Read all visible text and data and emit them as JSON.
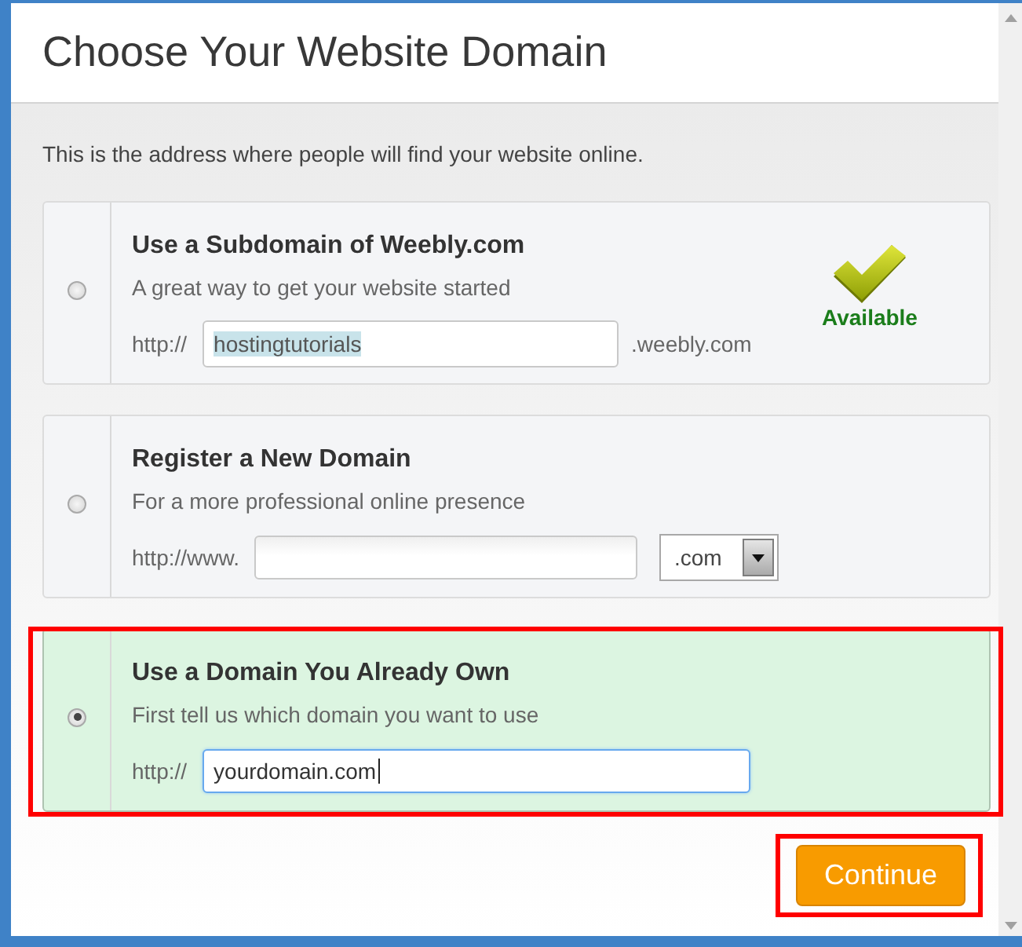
{
  "dialog": {
    "title": "Choose Your Website Domain",
    "intro": "This is the address where people will find your website online."
  },
  "options": [
    {
      "kind": "subdomain",
      "selected": false,
      "highlighted": false,
      "title": "Use a Subdomain of Weebly.com",
      "subtitle": "A great way to get your website started",
      "prefix": "http://",
      "value": "hostingtutorials",
      "value_selected": true,
      "focused": false,
      "suffix": ".weebly.com",
      "status": "Available"
    },
    {
      "kind": "register",
      "selected": false,
      "highlighted": false,
      "title": "Register a New Domain",
      "subtitle": "For a more professional online presence",
      "prefix": "http://www.",
      "extension": ".com"
    },
    {
      "kind": "existing",
      "selected": true,
      "highlighted": true,
      "title": "Use a Domain You Already Own",
      "subtitle": "First tell us which domain you want to use",
      "prefix": "http://",
      "value": "yourdomain.com",
      "value_selected": false,
      "focused": true
    }
  ],
  "continue_button": {
    "label": "Continue",
    "highlighted": true
  }
}
